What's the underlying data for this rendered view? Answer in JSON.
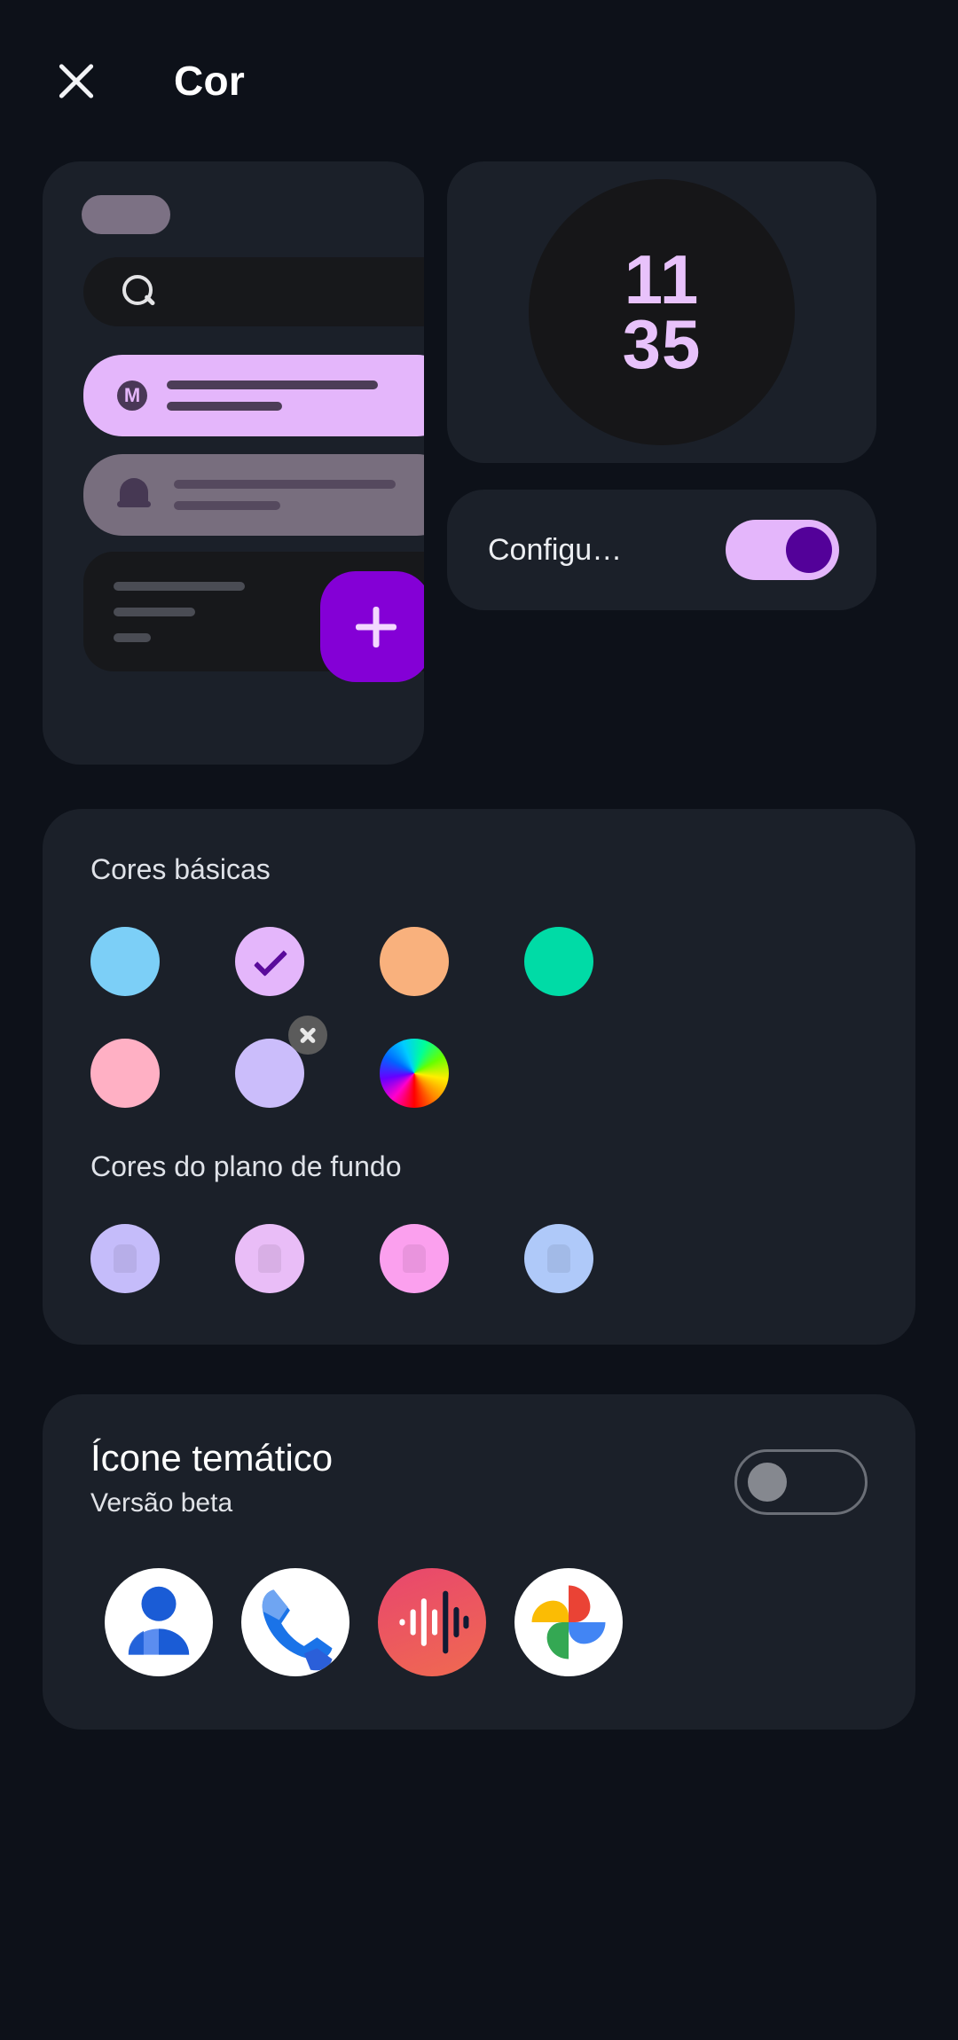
{
  "header": {
    "close_icon": "close-icon",
    "title": "Cor"
  },
  "preview": {
    "search_icon": "search-icon",
    "moto_icon": "motorola-logo-icon",
    "bell_icon": "bell-icon",
    "plus_icon": "plus-icon",
    "clock": {
      "hours": "11",
      "minutes": "35"
    },
    "quick_setting": {
      "label": "Configu…",
      "toggle_state": "on",
      "track_color": "#e4b6fb",
      "thumb_color": "#530199"
    }
  },
  "colors_card": {
    "basic_label": "Cores básicas",
    "background_label": "Cores do plano de fundo",
    "basic_colors": [
      {
        "name": "sky-blue",
        "hex": "#7ccff7",
        "selected": false,
        "removable": false
      },
      {
        "name": "light-purple",
        "hex": "#e4b6fb",
        "selected": true,
        "removable": false
      },
      {
        "name": "peach",
        "hex": "#f9b17d",
        "selected": false,
        "removable": false
      },
      {
        "name": "teal-green",
        "hex": "#00dba6",
        "selected": false,
        "removable": false
      },
      {
        "name": "pink",
        "hex": "#ffb0c4",
        "selected": false,
        "removable": false
      },
      {
        "name": "lavender",
        "hex": "#cbbdfb",
        "selected": false,
        "removable": true
      },
      {
        "name": "color-wheel",
        "hex": "wheel",
        "selected": false,
        "removable": false
      }
    ],
    "background_colors": [
      {
        "name": "lavender",
        "hex": "#c5bcfa"
      },
      {
        "name": "orchid",
        "hex": "#e9bdf7"
      },
      {
        "name": "hot-pink",
        "hex": "#fba0ee"
      },
      {
        "name": "powder-blue",
        "hex": "#afc9f9"
      }
    ]
  },
  "theme_icon_card": {
    "title": "Ícone temático",
    "subtitle": "Versão beta",
    "toggle_state": "off",
    "apps": [
      {
        "name": "contacts-app-icon"
      },
      {
        "name": "phone-app-icon"
      },
      {
        "name": "recorder-app-icon"
      },
      {
        "name": "photos-app-icon"
      }
    ]
  }
}
